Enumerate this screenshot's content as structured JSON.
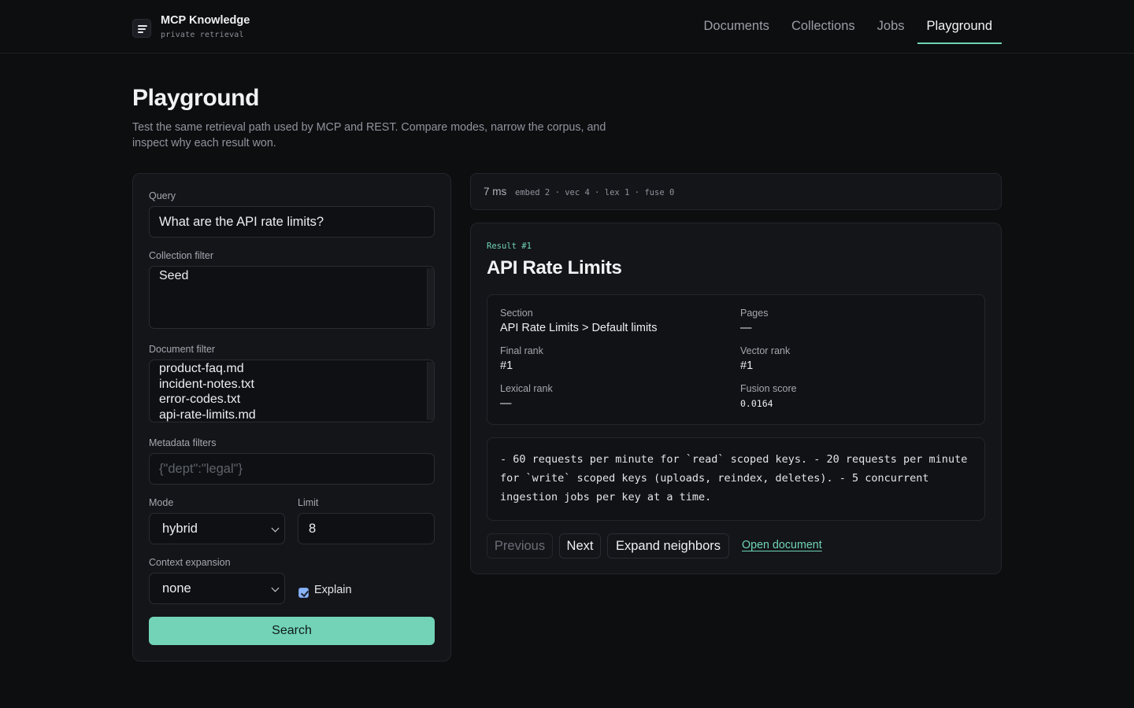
{
  "app": {
    "title": "MCP Knowledge",
    "subtitle": "private retrieval"
  },
  "nav": {
    "items": [
      {
        "label": "Documents",
        "active": false
      },
      {
        "label": "Collections",
        "active": false
      },
      {
        "label": "Jobs",
        "active": false
      },
      {
        "label": "Playground",
        "active": true
      }
    ]
  },
  "page": {
    "title": "Playground",
    "description": "Test the same retrieval path used by MCP and REST. Compare modes, narrow the corpus, and inspect why each result won."
  },
  "form": {
    "query_label": "Query",
    "query_value": "What are the API rate limits?",
    "collection_label": "Collection filter",
    "collection_options": [
      "Seed"
    ],
    "document_label": "Document filter",
    "document_options": [
      "product-faq.md",
      "incident-notes.txt",
      "error-codes.txt",
      "api-rate-limits.md"
    ],
    "metadata_label": "Metadata filters",
    "metadata_placeholder": "{\"dept\":\"legal\"}",
    "mode_label": "Mode",
    "mode_value": "hybrid",
    "limit_label": "Limit",
    "limit_value": "8",
    "context_label": "Context expansion",
    "context_value": "none",
    "explain_label": "Explain",
    "explain_checked": true,
    "search_label": "Search"
  },
  "timing": {
    "total": "7 ms",
    "detail": "embed 2 · vec 4 · lex 1 · fuse 0"
  },
  "result": {
    "tag": "Result #1",
    "title": "API Rate Limits",
    "meta": {
      "section_label": "Section",
      "section_value": "API Rate Limits > Default limits",
      "pages_label": "Pages",
      "pages_value": "—",
      "final_rank_label": "Final rank",
      "final_rank_value": "#1",
      "vector_rank_label": "Vector rank",
      "vector_rank_value": "#1",
      "lexical_rank_label": "Lexical rank",
      "lexical_rank_value": "—",
      "fusion_label": "Fusion score",
      "fusion_value": "0.0164"
    },
    "snippet": "- 60 requests per minute for `read` scoped keys. - 20 requests per minute for `write` scoped keys (uploads, reindex, deletes). - 5 concurrent ingestion jobs per key at a time.",
    "actions": {
      "previous": "Previous",
      "next": "Next",
      "expand": "Expand neighbors",
      "open": "Open document"
    }
  },
  "colors": {
    "accent": "#6fd3b5",
    "background": "#0d0e10",
    "panel": "#141519"
  }
}
